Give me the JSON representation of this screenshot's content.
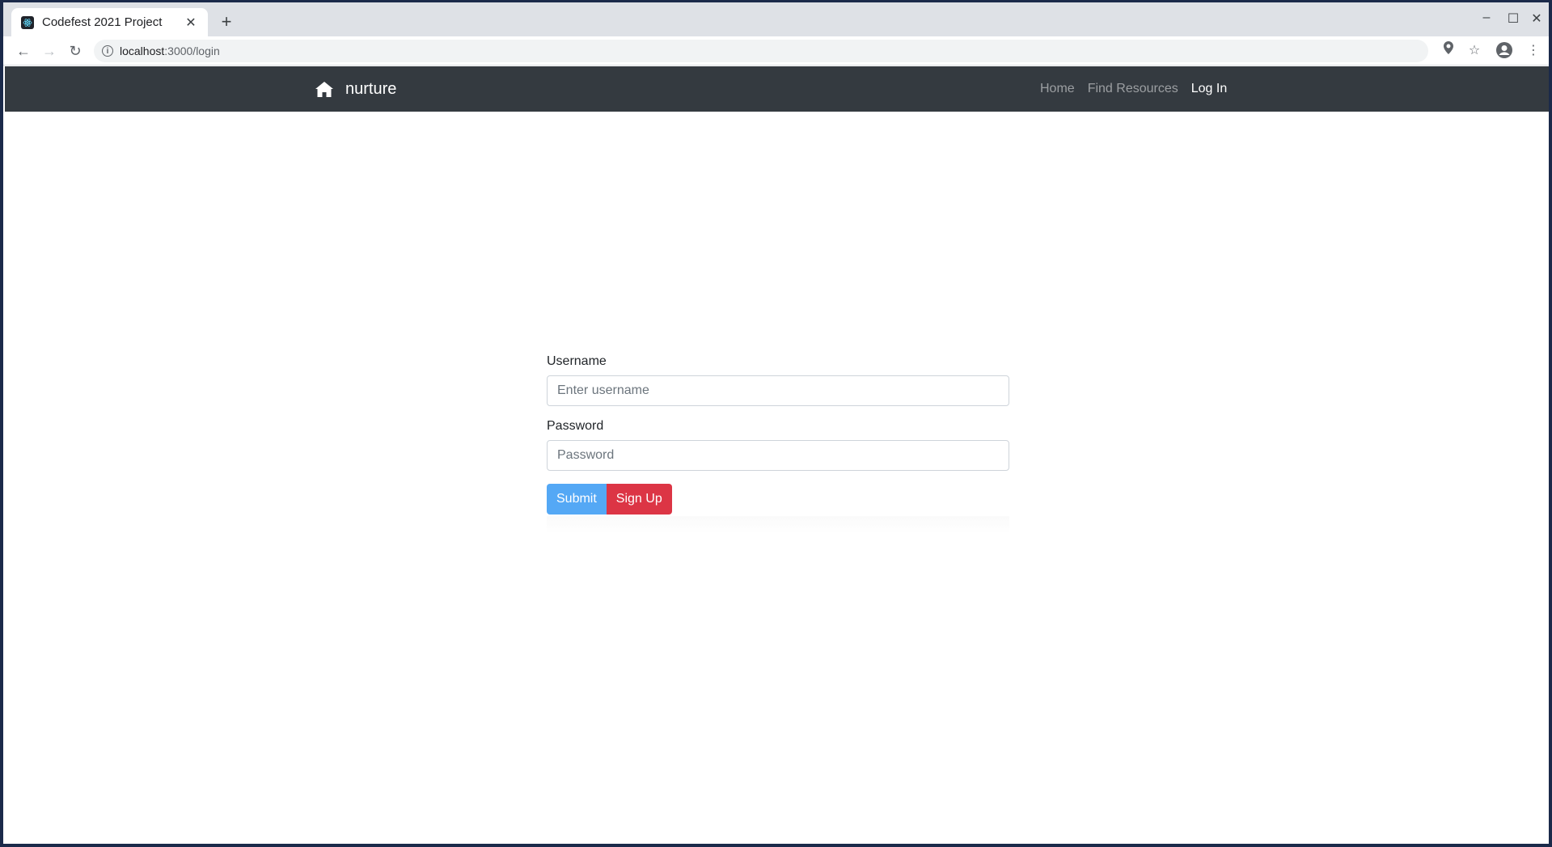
{
  "browser": {
    "tab_title": "Codefest 2021 Project",
    "url_host": "localhost",
    "url_path": ":3000/login"
  },
  "navbar": {
    "brand": "nurture",
    "links": [
      {
        "label": "Home",
        "active": false
      },
      {
        "label": "Find Resources",
        "active": false
      },
      {
        "label": "Log In",
        "active": true
      }
    ]
  },
  "login_form": {
    "username_label": "Username",
    "username_placeholder": "Enter username",
    "username_value": "",
    "password_label": "Password",
    "password_placeholder": "Password",
    "password_value": "",
    "submit_label": "Submit",
    "signup_label": "Sign Up"
  },
  "colors": {
    "navbar_bg": "#343a40",
    "submit_bg": "#54a8f5",
    "signup_bg": "#dc3545"
  }
}
